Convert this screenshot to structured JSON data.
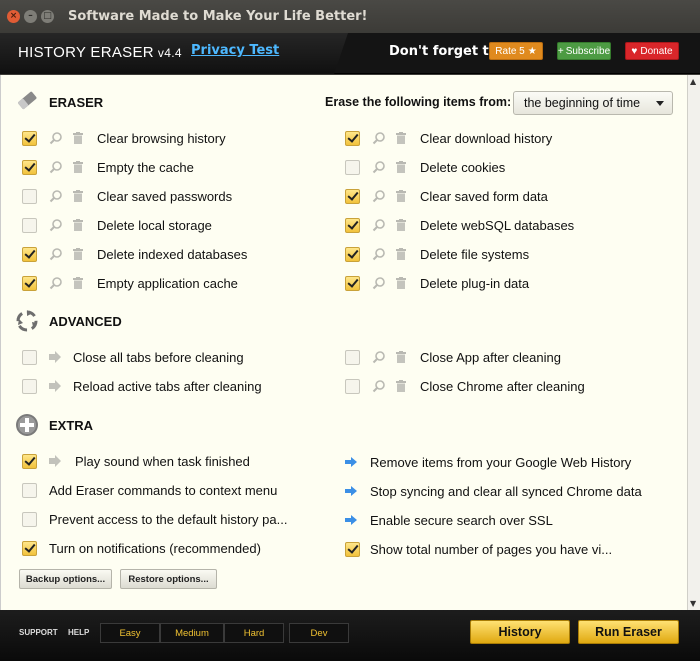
{
  "window": {
    "title": "Software Made to Make Your Life Better!"
  },
  "header": {
    "brand": "HISTORY ERASER",
    "version": "v4.4",
    "privacy_test": "Privacy Test",
    "dont_forget": "Don't forget to...",
    "rate": "Rate 5",
    "subscribe": "Subscribe",
    "donate": "Donate"
  },
  "eraser": {
    "title": "ERASER",
    "erase_from_label": "Erase the following items from:",
    "erase_from_value": "the beginning of time",
    "left": [
      {
        "label": "Clear browsing history",
        "checked": true
      },
      {
        "label": "Empty the cache",
        "checked": true
      },
      {
        "label": "Clear saved passwords",
        "checked": false
      },
      {
        "label": "Delete local storage",
        "checked": false
      },
      {
        "label": "Delete indexed databases",
        "checked": true
      },
      {
        "label": "Empty application cache",
        "checked": true
      }
    ],
    "right": [
      {
        "label": "Clear download history",
        "checked": true
      },
      {
        "label": "Delete cookies",
        "checked": false
      },
      {
        "label": "Clear saved form data",
        "checked": true
      },
      {
        "label": "Delete webSQL databases",
        "checked": true
      },
      {
        "label": "Delete file systems",
        "checked": true
      },
      {
        "label": "Delete plug-in data",
        "checked": true
      }
    ]
  },
  "advanced": {
    "title": "ADVANCED",
    "left": [
      {
        "label": "Close all tabs before cleaning",
        "checked": false
      },
      {
        "label": "Reload active tabs after cleaning",
        "checked": false
      }
    ],
    "right": [
      {
        "label": "Close App after cleaning",
        "checked": false
      },
      {
        "label": "Close Chrome after cleaning",
        "checked": false
      }
    ]
  },
  "extra": {
    "title": "EXTRA",
    "left": [
      {
        "label": "Play sound when task finished",
        "checked": true
      },
      {
        "label": "Add Eraser commands to context menu",
        "checked": false
      },
      {
        "label": "Prevent access to the default history pa...",
        "checked": false
      },
      {
        "label": "Turn on notifications (recommended)",
        "checked": true
      }
    ],
    "right": [
      {
        "label": "Remove items from your Google Web History"
      },
      {
        "label": "Stop syncing and clear all synced Chrome data"
      },
      {
        "label": "Enable secure search over SSL"
      },
      {
        "label": "Show total number of pages you have vi...",
        "checked": true
      }
    ],
    "backup": "Backup options...",
    "restore": "Restore options..."
  },
  "footer": {
    "support": "SUPPORT",
    "help": "HELP",
    "levels": [
      "Easy",
      "Medium",
      "Hard",
      "Dev"
    ],
    "history_btn": "History",
    "run_btn": "Run Eraser"
  },
  "colors": {
    "accent": "#f2c23c",
    "link": "#4db8ff",
    "panel": "#fefef2"
  }
}
